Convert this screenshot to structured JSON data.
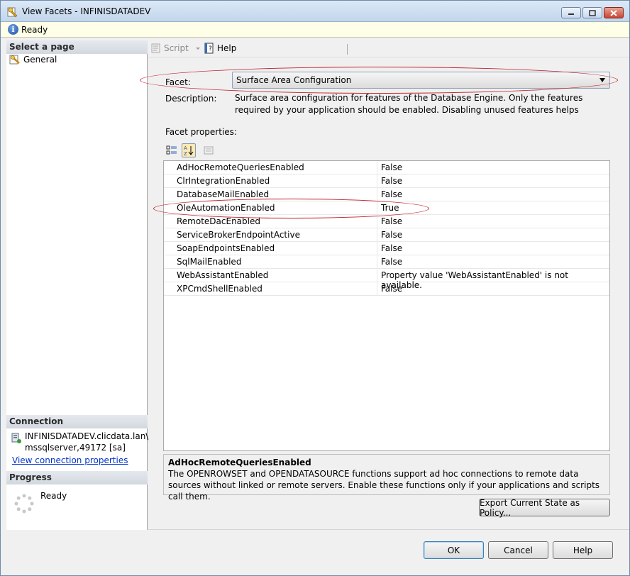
{
  "window": {
    "title": "View Facets - INFINISDATADEV"
  },
  "status": {
    "text": "Ready"
  },
  "left_panel": {
    "select_page_heading": "Select a page",
    "pages": [
      {
        "label": "General",
        "icon": "page-settings-icon"
      }
    ],
    "connection_heading": "Connection",
    "connection_line1": "INFINISDATADEV.clicdata.lan\\",
    "connection_line2": "mssqlserver,49172 [sa]",
    "view_connection_link": "View connection properties",
    "progress_heading": "Progress",
    "progress_text": "Ready"
  },
  "toolbar": {
    "script_label": "Script",
    "help_label": "Help"
  },
  "facet": {
    "label": "Facet:",
    "selected": "Surface Area Configuration",
    "description_label": "Description:",
    "description": "Surface area configuration for features of the Database Engine. Only the features required by your application should be enabled. Disabling unused features helps protect your server by reducing the"
  },
  "facet_properties": {
    "label": "Facet properties:",
    "rows": [
      {
        "name": "AdHocRemoteQueriesEnabled",
        "value": "False"
      },
      {
        "name": "ClrIntegrationEnabled",
        "value": "False"
      },
      {
        "name": "DatabaseMailEnabled",
        "value": "False"
      },
      {
        "name": "OleAutomationEnabled",
        "value": "True"
      },
      {
        "name": "RemoteDacEnabled",
        "value": "False"
      },
      {
        "name": "ServiceBrokerEndpointActive",
        "value": "False"
      },
      {
        "name": "SoapEndpointsEnabled",
        "value": "False"
      },
      {
        "name": "SqlMailEnabled",
        "value": "False"
      },
      {
        "name": "WebAssistantEnabled",
        "value": "Property value 'WebAssistantEnabled' is not available."
      },
      {
        "name": "XPCmdShellEnabled",
        "value": "False"
      }
    ]
  },
  "help_box": {
    "title": "AdHocRemoteQueriesEnabled",
    "text": "The OPENROWSET and OPENDATASOURCE functions support ad hoc connections to remote data sources without linked or remote servers. Enable these functions only if your applications and scripts call them."
  },
  "buttons": {
    "export": "Export Current State as Policy...",
    "ok": "OK",
    "cancel": "Cancel",
    "help": "Help"
  },
  "colors": {
    "annotation_ellipse": "#c4202a",
    "link": "#0033cc",
    "status_background": "#fffee6"
  }
}
